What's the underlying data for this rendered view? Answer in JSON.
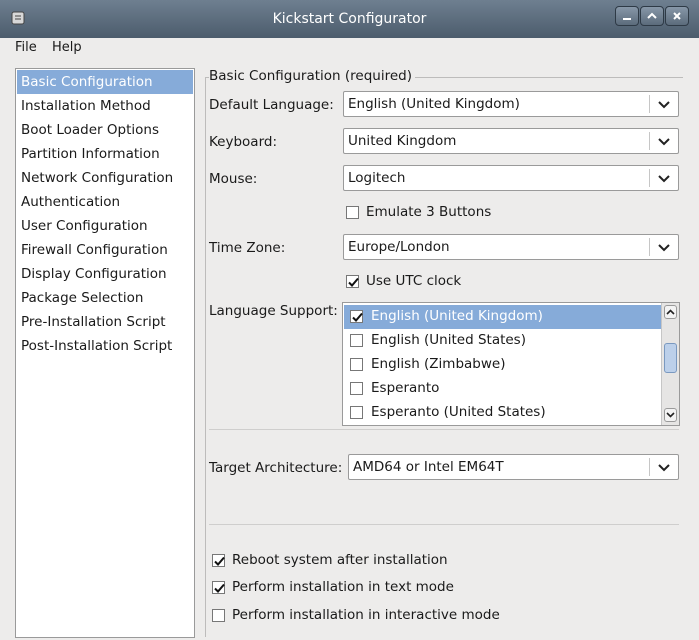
{
  "window": {
    "title": "Kickstart Configurator"
  },
  "menu": {
    "file": "File",
    "help": "Help"
  },
  "sidebar": {
    "items": [
      "Basic Configuration",
      "Installation Method",
      "Boot Loader Options",
      "Partition Information",
      "Network Configuration",
      "Authentication",
      "User Configuration",
      "Firewall Configuration",
      "Display Configuration",
      "Package Selection",
      "Pre-Installation Script",
      "Post-Installation Script"
    ],
    "selected": 0
  },
  "basic": {
    "group_title": "Basic Configuration (required)",
    "default_language": {
      "label": "Default Language:",
      "value": "English (United Kingdom)"
    },
    "keyboard": {
      "label": "Keyboard:",
      "value": "United Kingdom"
    },
    "mouse": {
      "label": "Mouse:",
      "value": "Logitech"
    },
    "emulate": {
      "label": "Emulate 3 Buttons",
      "checked": false
    },
    "timezone": {
      "label": "Time Zone:",
      "value": "Europe/London"
    },
    "utc": {
      "label": "Use UTC clock",
      "checked": true
    },
    "language_support": {
      "label": "Language Support:",
      "items": [
        {
          "label": "English (United Kingdom)",
          "checked": true,
          "selected": true
        },
        {
          "label": "English (United States)",
          "checked": false
        },
        {
          "label": "English (Zimbabwe)",
          "checked": false
        },
        {
          "label": "Esperanto",
          "checked": false
        },
        {
          "label": "Esperanto (United States)",
          "checked": false
        }
      ]
    },
    "target_arch": {
      "label": "Target Architecture:",
      "value": "AMD64 or Intel EM64T"
    },
    "reboot": {
      "label": "Reboot system after installation",
      "checked": true
    },
    "text_mode": {
      "label": "Perform installation in text mode",
      "checked": true
    },
    "interactive": {
      "label": "Perform installation in interactive mode",
      "checked": false
    }
  },
  "colors": {
    "selection": "#86abd9",
    "titlebar": "#5c6c7c"
  }
}
